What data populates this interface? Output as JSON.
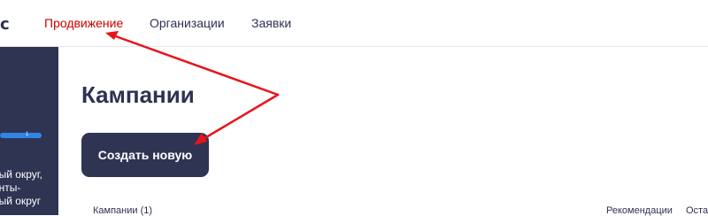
{
  "header": {
    "logo_text": "с",
    "nav": [
      {
        "label": "Продвижение",
        "active": true
      },
      {
        "label": "Организации",
        "active": false
      },
      {
        "label": "Заявки",
        "active": false
      }
    ]
  },
  "sidebar": {
    "progress_fraction": 1.0,
    "progress_label": "1",
    "region_text_lines": [
      "ный округ,",
      "анты-",
      "ный округ"
    ]
  },
  "main": {
    "title": "Кампании",
    "create_button": "Создать новую",
    "columns": {
      "campaigns": "Кампании (1)",
      "recommendations": "Рекомендации",
      "truncated": "Оста"
    }
  },
  "annotation": {
    "arrow_color": "#e8141c"
  },
  "colors": {
    "accent_red": "#cc0000",
    "brand_navy": "#303453",
    "progress_blue": "#2f86e5"
  }
}
